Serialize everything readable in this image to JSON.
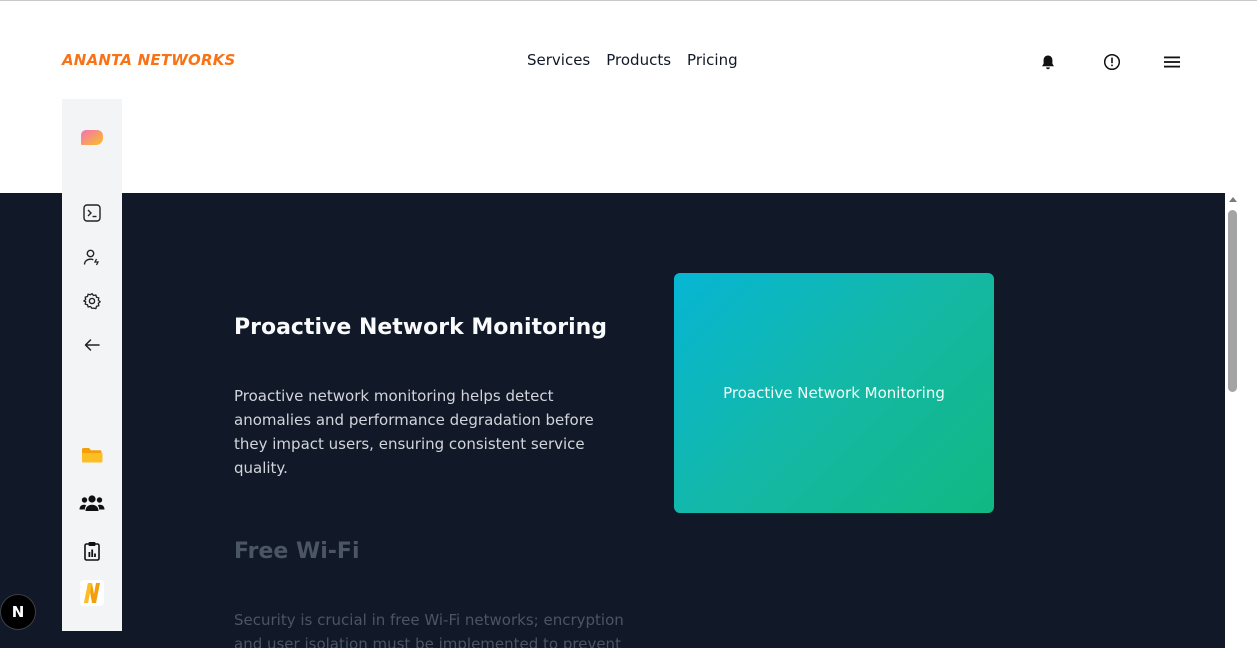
{
  "header": {
    "brand": "ANANTA NETWORKS",
    "nav": [
      "Services",
      "Products",
      "Pricing"
    ],
    "icons": [
      "bell-icon",
      "info-icon",
      "menu-icon"
    ]
  },
  "sidebar": {
    "icons": [
      "chat-bubble-icon",
      "terminal-icon",
      "user-add-icon",
      "gear-icon",
      "arrow-left-icon",
      "folder-icon",
      "users-icon",
      "clipboard-chart-icon",
      "n-logo-icon"
    ]
  },
  "main": {
    "sections": [
      {
        "title": "Proactive Network Monitoring",
        "text": "Proactive network monitoring helps detect anomalies and performance degradation before they impact users, ensuring consistent service quality."
      },
      {
        "title": "Free Wi-Fi",
        "text": "Security is crucial in free Wi-Fi networks; encryption and user isolation must be implemented to prevent"
      }
    ],
    "card_label": "Proactive Network Monitoring"
  },
  "badge": {
    "label": "N"
  },
  "colors": {
    "brand": "#f97316",
    "dark_bg": "#111827",
    "card_start": "#06b6d4",
    "card_end": "#10b981"
  }
}
